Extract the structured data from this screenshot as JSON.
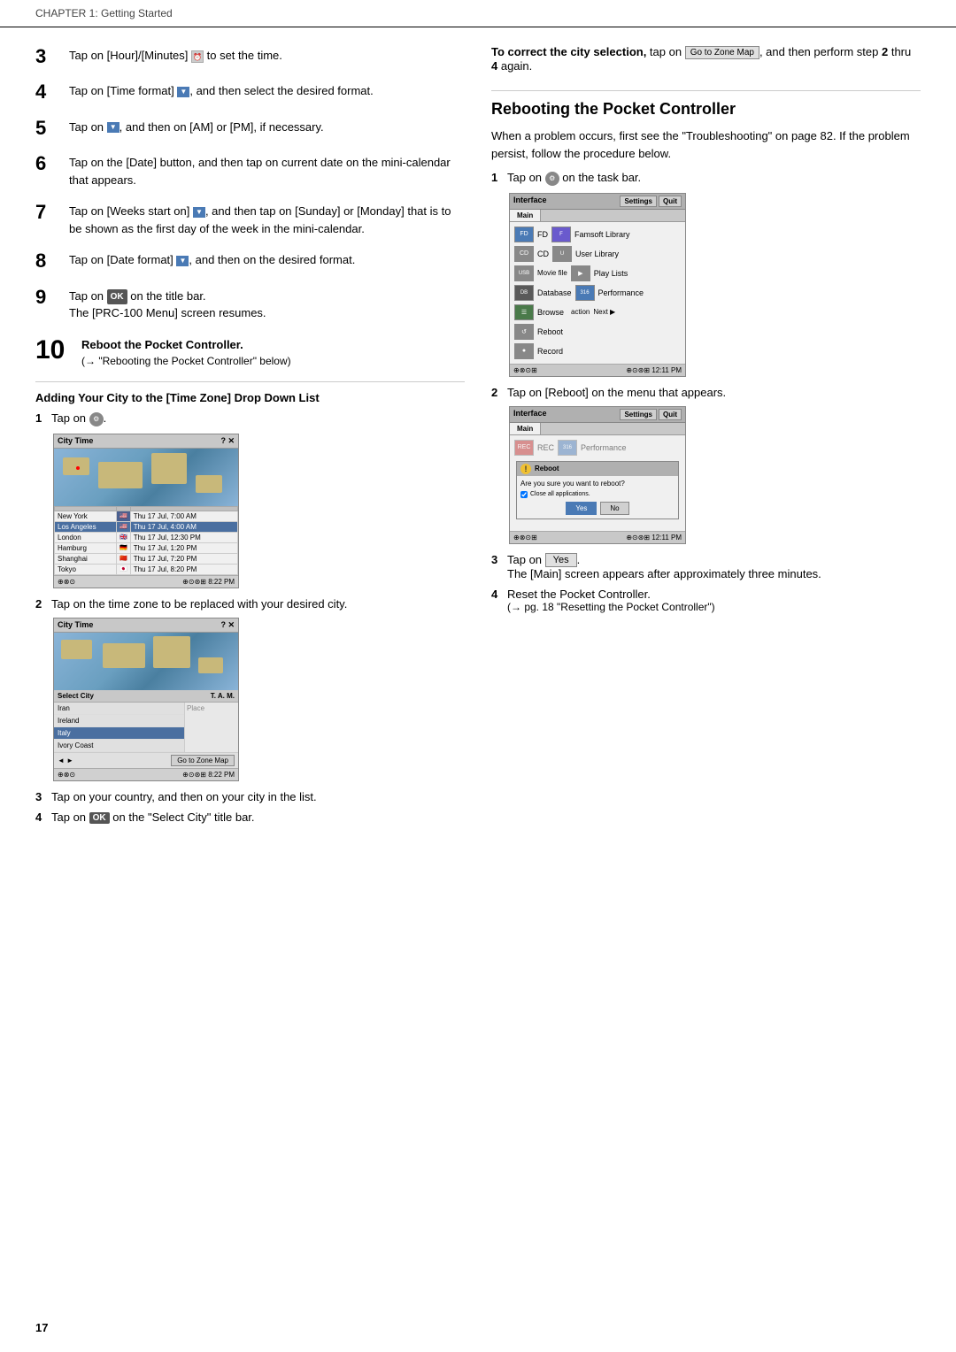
{
  "header": {
    "text": "CHAPTER 1: Getting Started"
  },
  "footer": {
    "page_number": "17"
  },
  "left_column": {
    "steps": [
      {
        "number": "3",
        "content": "Tap on [Hour]/[Minutes] to set the time."
      },
      {
        "number": "4",
        "content": "Tap on [Time format]",
        "content2": ", and then select the desired format."
      },
      {
        "number": "5",
        "content": "Tap on",
        "content2": ", and then on [AM] or [PM], if necessary."
      },
      {
        "number": "6",
        "content": "Tap on the [Date] button, and then tap on current date on the mini-calendar that appears."
      },
      {
        "number": "7",
        "content": "Tap on [Weeks start on]",
        "content2": ", and then tap on [Sunday] or [Monday] that is to be shown as the first day of the week in the mini-calendar."
      },
      {
        "number": "8",
        "content": "Tap on [Date format]",
        "content2": ", and then on the desired format."
      },
      {
        "number": "9",
        "content": "Tap on",
        "ok_label": "OK",
        "content2": "on the title bar.",
        "subtext": "The [PRC-100 Menu] screen resumes."
      },
      {
        "number": "10",
        "large": true,
        "content": "Reboot the Pocket Controller.",
        "subtext": "(→ \"Rebooting the Pocket Controller\" below)"
      }
    ],
    "adding_city_section": {
      "title": "Adding Your City to the [Time Zone] Drop Down List",
      "steps": [
        {
          "num": "1",
          "text": "Tap on"
        },
        {
          "num": "2",
          "text": "Tap on the time zone to be replaced with your desired city."
        },
        {
          "num": "3",
          "text": "Tap on your country, and then on your city in the list."
        },
        {
          "num": "4",
          "text": "Tap on",
          "ok": true,
          "text2": "on the \"Select City\" title bar."
        }
      ],
      "city_table1": {
        "title": "City Time",
        "rows": [
          {
            "city": "New York",
            "day": "Thu 17 Jul, 7:00 AM",
            "highlight": false
          },
          {
            "city": "Los Angeles",
            "day": "Thu 17 Jul, 4:00 AM",
            "highlight": true
          },
          {
            "city": "London",
            "day": "Thu 17 Jul, 12:30 PM",
            "highlight": false
          },
          {
            "city": "Hamburg",
            "day": "Thu 17 Jul, 1:20 PM",
            "highlight": false
          },
          {
            "city": "Shanghai",
            "day": "Thu 17 Jul, 7:20 PM",
            "highlight": false
          },
          {
            "city": "Tokyo",
            "day": "Thu 17 Jul, 8:20 PM",
            "highlight": false
          }
        ]
      },
      "city_table2": {
        "title": "City Time",
        "select_city_label": "Select City",
        "scroll_items": [
          "Iran",
          "Ireland",
          "Italy",
          "Ivory Coast"
        ],
        "go_btn": "Go to Zone Map"
      }
    }
  },
  "right_column": {
    "correct_city": {
      "label": "To correct the city selection,",
      "text": "tap on",
      "btn": "Go to Zone Map",
      "text2": ", and then perform step",
      "bold_num": "2",
      "text3": "thru",
      "bold_num2": "4",
      "text4": "again."
    },
    "rebooting_section": {
      "title": "Rebooting the Pocket Controller",
      "intro": "When a problem occurs, first see the \"Troubleshooting\" on page 82. If the problem persist, follow the procedure below.",
      "steps": [
        {
          "num": "1",
          "text": "Tap on",
          "icon": "gear",
          "text2": "on the task bar."
        },
        {
          "num": "2",
          "text": "Tap on [Reboot] on the menu that appears."
        },
        {
          "num": "3",
          "text": "Tap on",
          "btn": "Yes",
          "text2": ".",
          "subtext": "The [Main] screen appears after approximately three minutes."
        },
        {
          "num": "4",
          "text": "Reset the Pocket Controller.",
          "subtext": "(→ pg. 18 \"Resetting the Pocket Controller\")"
        }
      ],
      "interface_screen1": {
        "title": "Interface",
        "tab": "Main",
        "rows": [
          {
            "label": "FD",
            "icon_type": "blue",
            "label2": "Famsoft Library"
          },
          {
            "label": "CD",
            "icon_type": "gray",
            "label2": "User Library"
          },
          {
            "label": "USB",
            "icon_type": "gray",
            "label2": "Play Lists"
          },
          {
            "label": "Database",
            "icon_type": "gray",
            "label2": "Performance"
          },
          {
            "label": "Browse",
            "icon_type": "gray",
            "label2": ""
          },
          {
            "label": "Reboot",
            "icon_type": "gray",
            "label2": ""
          },
          {
            "label": "Record",
            "icon_type": "gray",
            "label2": ""
          }
        ]
      },
      "interface_screen2": {
        "title": "Interface",
        "tab": "Main",
        "dialog_title": "Reboot",
        "dialog_question": "Are you sure you want to reboot?",
        "dialog_checkbox": "Close all applications.",
        "dialog_yes": "Yes",
        "dialog_no": "No"
      }
    }
  }
}
